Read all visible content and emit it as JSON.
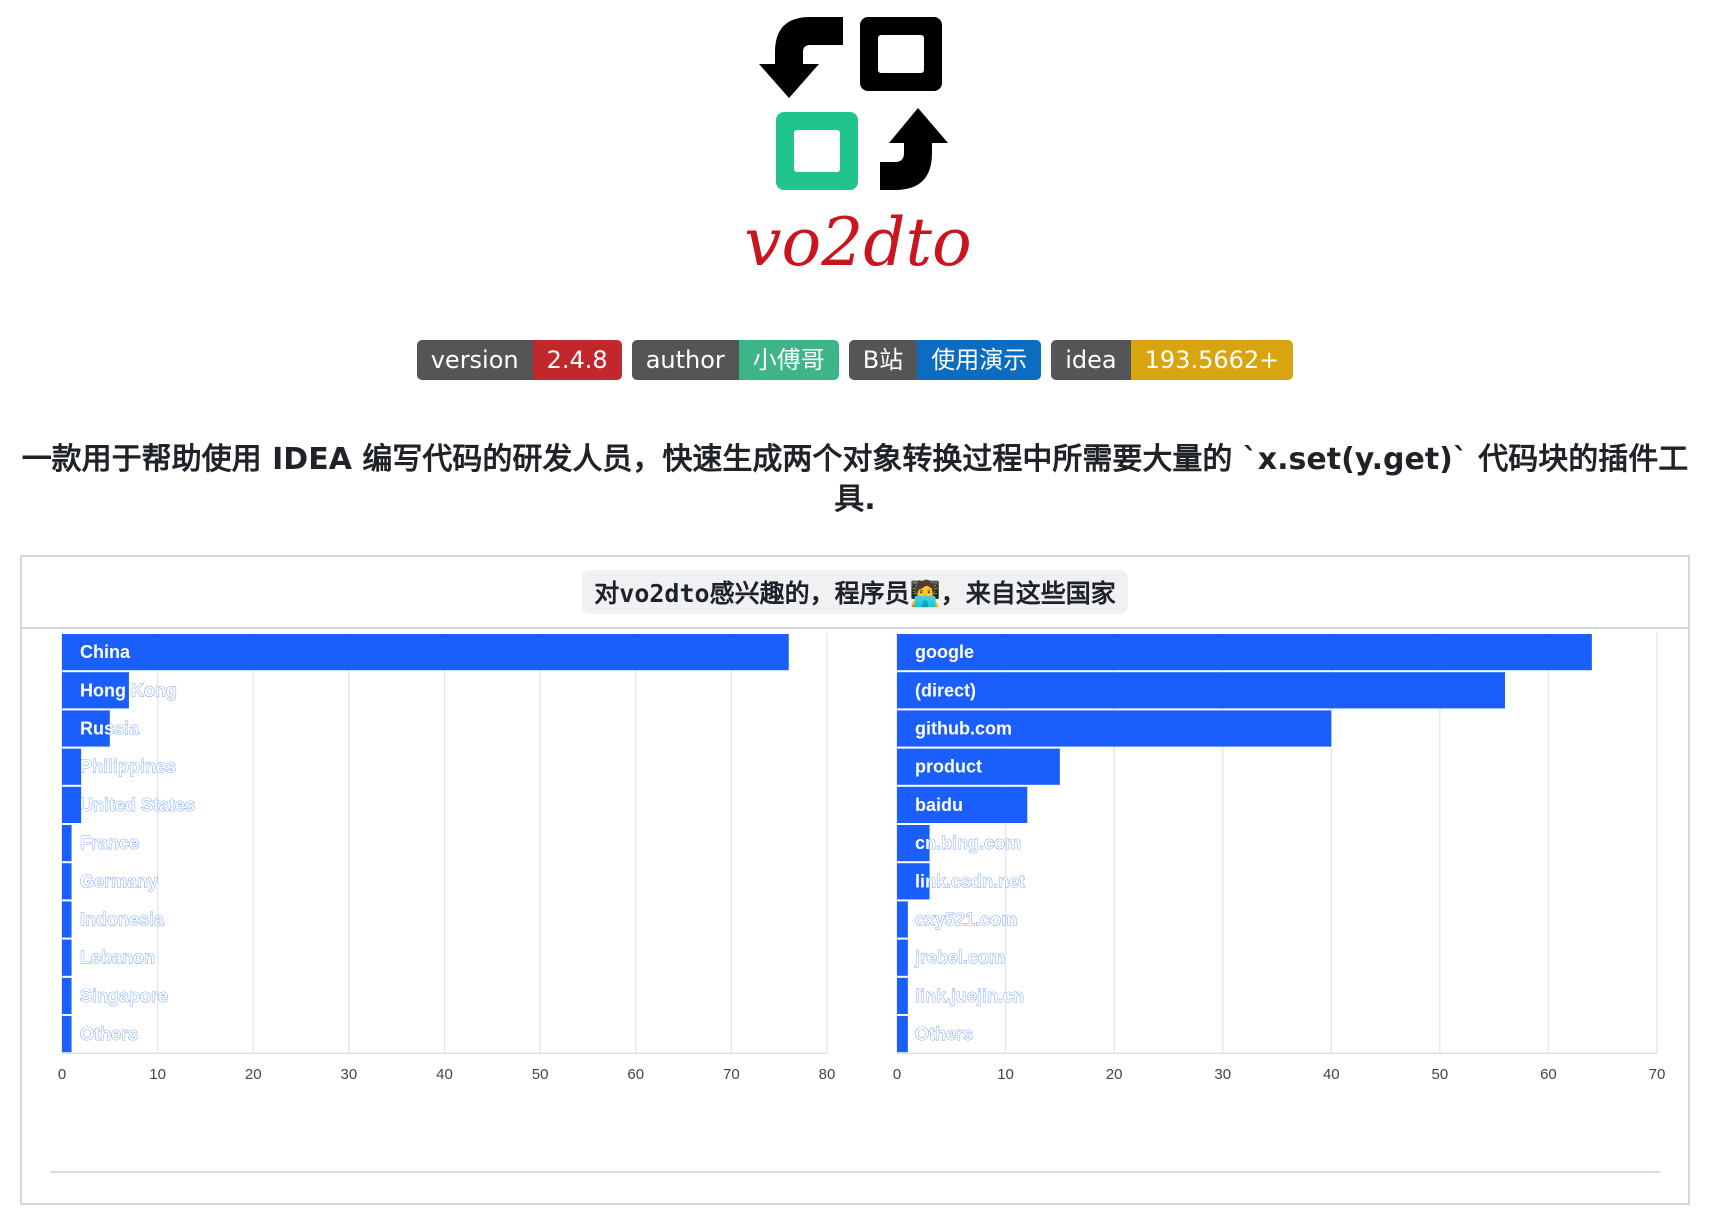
{
  "logo": {
    "wordmark": "vo2dto",
    "wordmark_color": "#c9151e",
    "accent_green": "#21c48b"
  },
  "badges": [
    {
      "label": "version",
      "value": "2.4.8",
      "color": "#c1272d"
    },
    {
      "label": "author",
      "value": "小傅哥",
      "color": "#3eb489"
    },
    {
      "label": "B站",
      "value": "使用演示",
      "color": "#0c6cc1"
    },
    {
      "label": "idea",
      "value": "193.5662+",
      "color": "#d9a50f"
    }
  ],
  "tagline": "一款用于帮助使用 IDEA 编写代码的研发人员，快速生成两个对象转换过程中所需要大量的 `x.set(y.get)` 代码块的插件工具.",
  "panel": {
    "title": "对vo2dto感兴趣的，程序员🧑‍💻，来自这些国家"
  },
  "chart_data": [
    {
      "type": "bar",
      "orientation": "horizontal",
      "categories": [
        "China",
        "Hong Kong",
        "Russia",
        "Philippines",
        "United States",
        "France",
        "Germany",
        "Indonesia",
        "Lebanon",
        "Singapore",
        "Others"
      ],
      "values": [
        76,
        7,
        5,
        2,
        2,
        1,
        1,
        1,
        1,
        1,
        1
      ],
      "xlim": [
        0,
        80
      ],
      "xticks": [
        0,
        10,
        20,
        30,
        40,
        50,
        60,
        70,
        80
      ],
      "grid": true,
      "bar_color": "#1a5ffc"
    },
    {
      "type": "bar",
      "orientation": "horizontal",
      "categories": [
        "google",
        "(direct)",
        "github.com",
        "product",
        "baidu",
        "cn.bing.com",
        "link.csdn.net",
        "cxy521.com",
        "jrebel.com",
        "link.juejin.cn",
        "Others"
      ],
      "values": [
        64,
        56,
        40,
        15,
        12,
        3,
        3,
        1,
        1,
        1,
        1
      ],
      "xlim": [
        0,
        70
      ],
      "xticks": [
        0,
        10,
        20,
        30,
        40,
        50,
        60,
        70
      ],
      "grid": true,
      "bar_color": "#1a5ffc"
    }
  ]
}
